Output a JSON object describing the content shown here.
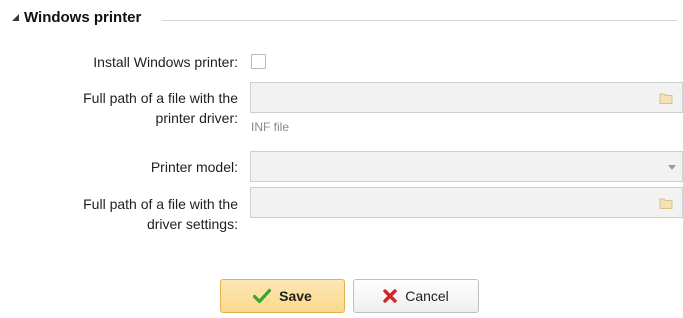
{
  "section": {
    "title": "Windows printer"
  },
  "form": {
    "install_label": "Install Windows printer:",
    "install_checked": false,
    "driver_path_label_line1": "Full path of a file with the",
    "driver_path_label_line2": "printer driver:",
    "driver_path_value": "",
    "driver_path_hint": "INF file",
    "printer_model_label": "Printer model:",
    "printer_model_value": "",
    "settings_path_label_line1": "Full path of a file with the",
    "settings_path_label_line2": "driver settings:",
    "settings_path_value": ""
  },
  "buttons": {
    "save_label": "Save",
    "cancel_label": "Cancel"
  },
  "icons": {
    "save": "checkmark-icon",
    "cancel": "x-icon",
    "browse": "folder-icon",
    "collapse": "triangle-collapse-icon"
  },
  "colors": {
    "save_bg": "#fbd98d",
    "checkmark": "#3aa534",
    "cancel_x": "#d0262b"
  }
}
